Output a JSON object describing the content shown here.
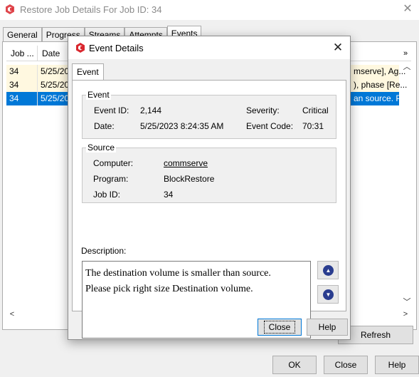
{
  "parent": {
    "title": "Restore Job Details For Job ID: 34",
    "tabs": [
      "General",
      "Progress",
      "Streams",
      "Attempts",
      "Events"
    ],
    "columns": [
      "Job ...",
      "Date"
    ],
    "rows": [
      {
        "job": "34",
        "date": "5/25/20",
        "tail": "mserve], Ag..."
      },
      {
        "job": "34",
        "date": "5/25/20",
        "tail": "), phase [Re..."
      },
      {
        "job": "34",
        "date": "5/25/20",
        "tail": "an source. P..."
      }
    ],
    "refresh_label": "Refresh",
    "ok_label": "OK",
    "close_label": "Close",
    "help_label": "Help"
  },
  "dialog": {
    "title": "Event Details",
    "tab": "Event",
    "event_group": "Event",
    "event_id_label": "Event ID:",
    "event_id": "2,144",
    "severity_label": "Severity:",
    "severity": "Critical",
    "date_label": "Date:",
    "date": "5/25/2023 8:24:35 AM",
    "event_code_label": "Event Code:",
    "event_code": "70:31",
    "source_group": "Source",
    "computer_label": "Computer:",
    "computer": "commserve",
    "program_label": "Program:",
    "program": "BlockRestore",
    "job_id_label": "Job ID:",
    "job_id": "34",
    "description_label": "Description:",
    "description_line1": "The destination volume is smaller than source.",
    "description_line2": "Please pick right size Destination volume.",
    "close_label": "Close",
    "help_label": "Help"
  },
  "icons": {
    "app": "commvault-logo-icon",
    "close": "close-icon",
    "prev": "up-arrow-icon",
    "next": "down-arrow-icon"
  },
  "colors": {
    "selection": "#0078d7",
    "cream_row": "#fff8e0",
    "logo_red": "#d9272e",
    "nav_blue": "#2a3d8f"
  }
}
